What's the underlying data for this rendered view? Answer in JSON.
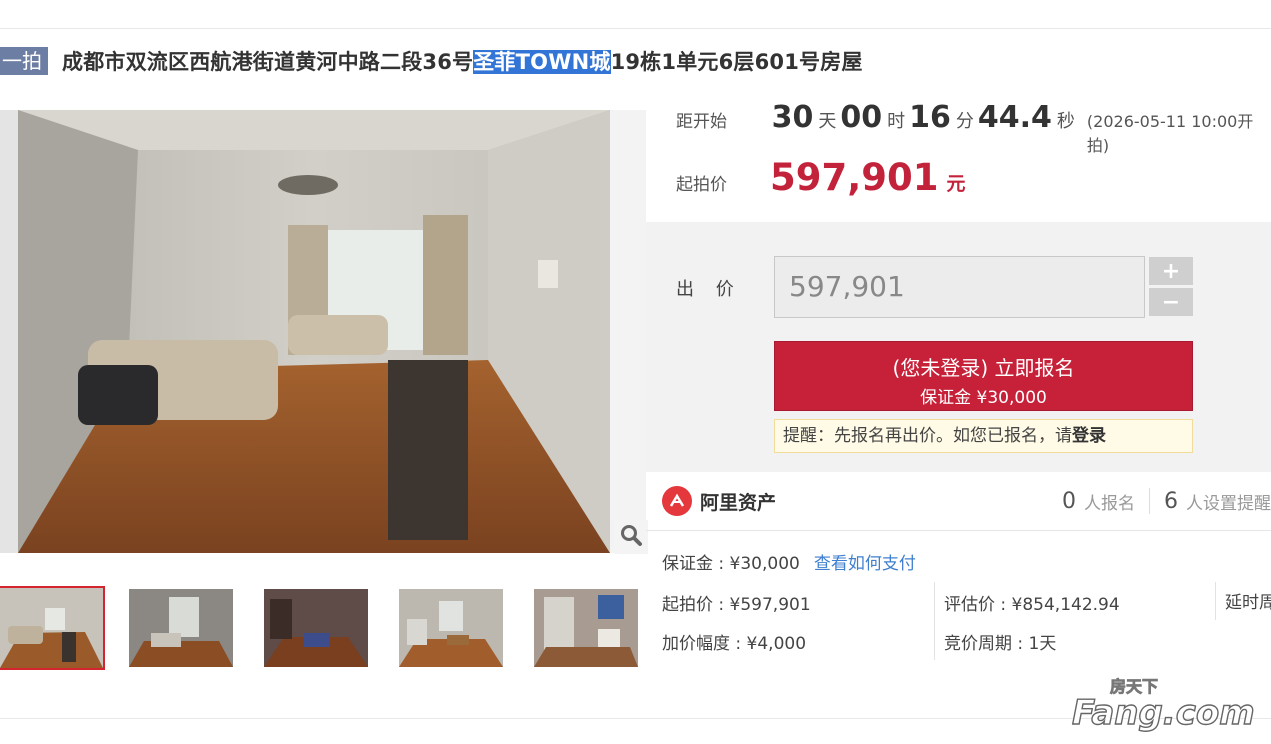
{
  "header": {
    "badge": "一拍",
    "title_before": "成都市双流区西航港街道黄河中路二段36号",
    "title_highlight": "圣菲TOWN城",
    "title_after": "19栋1单元6层601号房屋"
  },
  "countdown": {
    "label": "距开始",
    "days": "30",
    "days_unit": "天",
    "hours": "00",
    "hours_unit": "时",
    "minutes": "16",
    "minutes_unit": "分",
    "seconds": "44.4",
    "seconds_unit": "秒",
    "start_note": "(2026-05-11 10:00开拍)"
  },
  "start_price": {
    "label": "起拍价",
    "value": "597,901",
    "unit": "元"
  },
  "bid": {
    "label": "出 价",
    "input_value": "597,901",
    "plus": "+",
    "minus": "−",
    "signup_line1": "(您未登录) 立即报名",
    "signup_line2": "保证金 ¥30,000",
    "reminder_text": "提醒：先报名再出价。如您已报名，请",
    "reminder_link": "登录"
  },
  "platform": {
    "name": "阿里资产",
    "signups_count": "0",
    "signups_label": "人报名",
    "reminders_count": "6",
    "reminders_label": "人设置提醒"
  },
  "details": {
    "deposit": "保证金 : ¥30,000",
    "pay_link": "查看如何支付",
    "start_price": "起拍价 : ¥597,901",
    "appraisal": "评估价 : ¥854,142.94",
    "delay": "延时周",
    "increment": "加价幅度 : ¥4,000",
    "cycle": "竞价周期 : 1天"
  },
  "watermark": {
    "text_top": "房天下",
    "text_main": "Fang.com"
  },
  "colors": {
    "accent_red": "#c7213a",
    "badge_blue": "#6c7ea3",
    "highlight_blue": "#3375d6",
    "link_blue": "#3f7fcf"
  }
}
